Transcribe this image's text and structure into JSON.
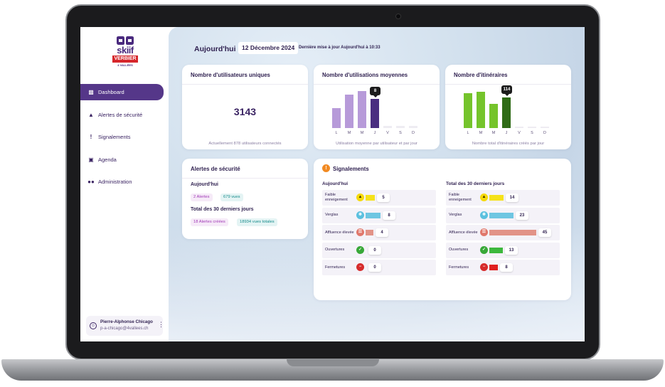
{
  "app": {
    "logo_word": "skiif",
    "logo_badge": "VERBIER",
    "logo_sub": "4 VALLÉES"
  },
  "sidebar": {
    "items": [
      {
        "label": "Dashboard",
        "icon": "bar-chart-icon",
        "active": true
      },
      {
        "label": "Alertes de sécurité",
        "icon": "warning-triangle-icon",
        "active": false
      },
      {
        "label": "Signalements",
        "icon": "exclamation-icon",
        "active": false
      },
      {
        "label": "Agenda",
        "icon": "calendar-icon",
        "active": false
      },
      {
        "label": "Administration",
        "icon": "users-icon",
        "active": false
      }
    ],
    "user": {
      "name": "Pierre-Alphonse Chicago",
      "email": "p-a-chicago@4vallees.ch"
    }
  },
  "header": {
    "title": "Aujourd'hui",
    "date": "12 Décembre 2024",
    "updated": "Dernière mise à jour Aujourd'hui à 10:33"
  },
  "unique_users": {
    "title": "Nombre d'utilisateurs uniques",
    "value": "3143",
    "caption": "Actuellement 878 utilisateurs connectés"
  },
  "avg_usage": {
    "title": "Nombre d'utilisations moyennes",
    "caption": "Utilisation moyenne par utilisateur et par jour",
    "tooltip": "8"
  },
  "itineraries": {
    "title": "Nombre d'itinéraires",
    "caption": "Nombre total d'itinéraires créés par jour",
    "tooltip": "114"
  },
  "chart_data": [
    {
      "type": "bar",
      "categories": [
        "L",
        "M",
        "M",
        "J",
        "V",
        "S",
        "D"
      ],
      "values": [
        5.5,
        9.2,
        10.2,
        8,
        0.6,
        0.6,
        0.6
      ],
      "colors": [
        "#b79ad9",
        "#b79ad9",
        "#b79ad9",
        "#4a2e80",
        "#eeecf2",
        "#eeecf2",
        "#eeecf2"
      ],
      "ylim": [
        0,
        11
      ]
    },
    {
      "type": "bar",
      "categories": [
        "L",
        "M",
        "M",
        "J",
        "V",
        "S",
        "D"
      ],
      "values": [
        130,
        136,
        92,
        114,
        6,
        6,
        6
      ],
      "colors": [
        "#75c42b",
        "#75c42b",
        "#75c42b",
        "#2f6b16",
        "#eeecf2",
        "#eeecf2",
        "#eeecf2"
      ],
      "ylim": [
        0,
        150
      ]
    }
  ],
  "security": {
    "title": "Alertes de sécurité",
    "today_label": "Aujourd'hui",
    "today_alerts": "2 Alertes",
    "today_views": "679 vues",
    "month_label": "Total des 30 derniers jours",
    "month_alerts": "18 Alertes créées",
    "month_views": "18934 vues totales"
  },
  "reports": {
    "title": "Signalements",
    "today_title": "Aujourd'hui",
    "month_title": "Total des 30 derniers jours",
    "rows": [
      {
        "label": "Faible enneigement",
        "icon": "snowflake-warning-icon",
        "icon_color": "#f5d90a",
        "bar_color": "#f5e21a",
        "today": "5",
        "month": "14",
        "today_frac": 0.2,
        "month_frac": 0.31
      },
      {
        "label": "Verglas",
        "icon": "ice-icon",
        "icon_color": "#5bc0df",
        "bar_color": "#6fc6e2",
        "today": "8",
        "month": "23",
        "today_frac": 0.32,
        "month_frac": 0.51
      },
      {
        "label": "Affluence élevée",
        "icon": "crowd-icon",
        "icon_color": "#e0776b",
        "bar_color": "#e29387",
        "today": "4",
        "month": "45",
        "today_frac": 0.16,
        "month_frac": 1.0
      },
      {
        "label": "Ouvertures",
        "icon": "check-icon",
        "icon_color": "#38a838",
        "bar_color": "#3db83d",
        "today": "0",
        "month": "13",
        "today_frac": 0,
        "month_frac": 0.29
      },
      {
        "label": "Fermetures",
        "icon": "minus-icon",
        "icon_color": "#d62b2b",
        "bar_color": "#e01f1f",
        "today": "0",
        "month": "8",
        "today_frac": 0,
        "month_frac": 0.18
      }
    ]
  }
}
